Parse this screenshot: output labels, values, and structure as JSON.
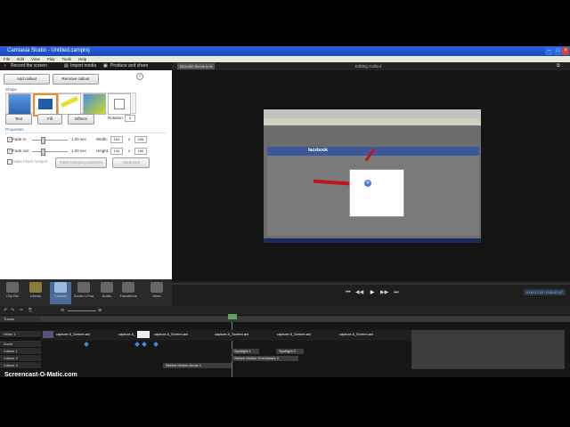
{
  "window": {
    "title": "Camtasia Studio - Untitled.camproj"
  },
  "menu": [
    "File",
    "Edit",
    "View",
    "Play",
    "Tools",
    "Help"
  ],
  "toolbar": {
    "record": "Record the screen",
    "import": "Import media",
    "produce": "Produce and share"
  },
  "preview_bar": {
    "dimensions": "640x480 Shrink to fit",
    "title": "Editing Callout"
  },
  "callouts": {
    "add_button": "Add callout",
    "remove_button": "Remove callout",
    "shape_section": "Shape",
    "text_button": "Text",
    "fill_button": "Fill",
    "effects_button": "Effects",
    "rotation_label": "Rotation:",
    "rotation_value": "0",
    "properties_section": "Properties",
    "fade_in": {
      "label": "Fade in:",
      "value": "1.00 sec"
    },
    "fade_out": {
      "label": "Fade out:",
      "value": "1.00 sec"
    },
    "width": {
      "label": "Width:",
      "value": "163",
      "pct": "255"
    },
    "height": {
      "label": "Height:",
      "value": "134",
      "pct": "150"
    },
    "make_flash": "Make Flash hotspot",
    "flash_props": "Flash hotspot properties",
    "advanced": "Advanced"
  },
  "tasks": [
    "Clip Bin",
    "Library",
    "Callouts",
    "Zoom-n-Pan",
    "Audio",
    "Transitions",
    "More"
  ],
  "timeline": {
    "tracks_label": "Tracks",
    "rows": [
      "Video 1",
      "Zoom",
      "Callout 1",
      "Callout 2",
      "Callout 3"
    ],
    "video_clips": [
      "capture-5_Screen.avi",
      "capture-5_",
      "capture-5_Screen.avi",
      "capture-5_Screen.avi",
      "capture-5_Screen.avi",
      "capture-5_Screen.avi"
    ],
    "callout_clips": [
      "Spotlight 1",
      "Spotlight 2",
      "Sketch Motion Checkmark 2",
      "Sketch Motion Arrow 1"
    ],
    "time_display": "0:00:17;15 / 0:02:22;07"
  },
  "preview_content": {
    "site_name": "facebook"
  },
  "watermark": "Screencast-O-Matic.com",
  "colors": {
    "accent": "#2a5fd8",
    "panel_bg": "#1c1c1c",
    "timeline_blue": "#3a8fe8"
  }
}
